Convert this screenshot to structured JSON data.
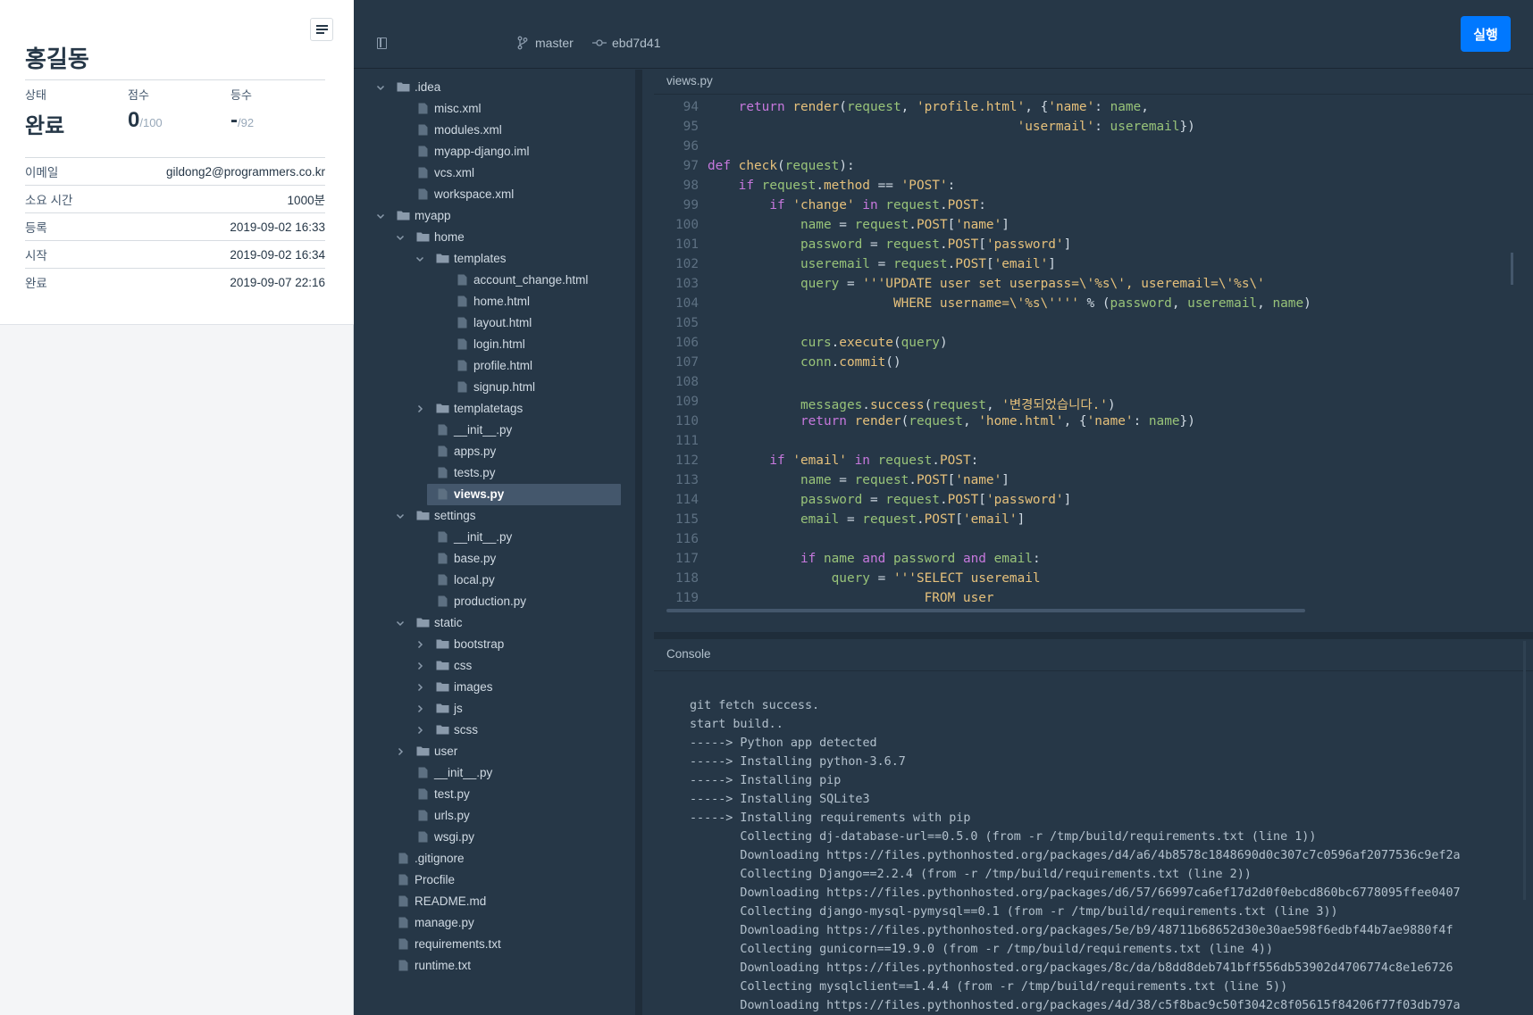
{
  "profile": {
    "name": "홍길동",
    "stats": [
      {
        "label": "상태",
        "value": "완료",
        "suffix": ""
      },
      {
        "label": "점수",
        "value": "0",
        "suffix": "/100"
      },
      {
        "label": "등수",
        "value": "-",
        "suffix": "/92"
      }
    ],
    "details": [
      {
        "key": "이메일",
        "value": "gildong2@programmers.co.kr"
      },
      {
        "key": "소요 시간",
        "value": "1000분"
      },
      {
        "key": "등록",
        "value": "2019-09-02 16:33"
      },
      {
        "key": "시작",
        "value": "2019-09-02 16:34"
      },
      {
        "key": "완료",
        "value": "2019-09-07 22:16"
      }
    ]
  },
  "topbar": {
    "branch": "master",
    "commit": "ebd7d41",
    "run_label": "실행"
  },
  "file_tree": [
    {
      "depth": 0,
      "type": "folder",
      "open": true,
      "name": ".idea"
    },
    {
      "depth": 1,
      "type": "file",
      "name": "misc.xml"
    },
    {
      "depth": 1,
      "type": "file",
      "name": "modules.xml"
    },
    {
      "depth": 1,
      "type": "file",
      "name": "myapp-django.iml"
    },
    {
      "depth": 1,
      "type": "file",
      "name": "vcs.xml"
    },
    {
      "depth": 1,
      "type": "file",
      "name": "workspace.xml"
    },
    {
      "depth": 0,
      "type": "folder",
      "open": true,
      "name": "myapp"
    },
    {
      "depth": 1,
      "type": "folder",
      "open": true,
      "name": "home"
    },
    {
      "depth": 2,
      "type": "folder",
      "open": true,
      "name": "templates"
    },
    {
      "depth": 3,
      "type": "file",
      "name": "account_change.html"
    },
    {
      "depth": 3,
      "type": "file",
      "name": "home.html"
    },
    {
      "depth": 3,
      "type": "file",
      "name": "layout.html"
    },
    {
      "depth": 3,
      "type": "file",
      "name": "login.html"
    },
    {
      "depth": 3,
      "type": "file",
      "name": "profile.html"
    },
    {
      "depth": 3,
      "type": "file",
      "name": "signup.html"
    },
    {
      "depth": 2,
      "type": "folder",
      "open": false,
      "name": "templatetags"
    },
    {
      "depth": 2,
      "type": "file",
      "name": "__init__.py"
    },
    {
      "depth": 2,
      "type": "file",
      "name": "apps.py"
    },
    {
      "depth": 2,
      "type": "file",
      "name": "tests.py"
    },
    {
      "depth": 2,
      "type": "file",
      "name": "views.py",
      "selected": true
    },
    {
      "depth": 1,
      "type": "folder",
      "open": true,
      "name": "settings"
    },
    {
      "depth": 2,
      "type": "file",
      "name": "__init__.py"
    },
    {
      "depth": 2,
      "type": "file",
      "name": "base.py"
    },
    {
      "depth": 2,
      "type": "file",
      "name": "local.py"
    },
    {
      "depth": 2,
      "type": "file",
      "name": "production.py"
    },
    {
      "depth": 1,
      "type": "folder",
      "open": true,
      "name": "static"
    },
    {
      "depth": 2,
      "type": "folder",
      "open": false,
      "name": "bootstrap"
    },
    {
      "depth": 2,
      "type": "folder",
      "open": false,
      "name": "css"
    },
    {
      "depth": 2,
      "type": "folder",
      "open": false,
      "name": "images"
    },
    {
      "depth": 2,
      "type": "folder",
      "open": false,
      "name": "js"
    },
    {
      "depth": 2,
      "type": "folder",
      "open": false,
      "name": "scss"
    },
    {
      "depth": 1,
      "type": "folder",
      "open": false,
      "name": "user"
    },
    {
      "depth": 1,
      "type": "file",
      "name": "__init__.py"
    },
    {
      "depth": 1,
      "type": "file",
      "name": "test.py"
    },
    {
      "depth": 1,
      "type": "file",
      "name": "urls.py"
    },
    {
      "depth": 1,
      "type": "file",
      "name": "wsgi.py"
    },
    {
      "depth": 0,
      "type": "file",
      "name": ".gitignore"
    },
    {
      "depth": 0,
      "type": "file",
      "name": "Procfile"
    },
    {
      "depth": 0,
      "type": "file",
      "name": "README.md"
    },
    {
      "depth": 0,
      "type": "file",
      "name": "manage.py"
    },
    {
      "depth": 0,
      "type": "file",
      "name": "requirements.txt"
    },
    {
      "depth": 0,
      "type": "file",
      "name": "runtime.txt"
    }
  ],
  "editor": {
    "tab": "views.py",
    "lines": [
      {
        "n": "94",
        "t": [
          [
            "    ",
            ""
          ],
          [
            "return",
            "kw"
          ],
          [
            " ",
            ""
          ],
          [
            "render",
            "fn"
          ],
          [
            "(",
            "pn"
          ],
          [
            "request",
            "dbg"
          ],
          [
            ", ",
            "pn"
          ],
          [
            "'profile.html'",
            "str"
          ],
          [
            ", {",
            "pn"
          ],
          [
            "'name'",
            "str"
          ],
          [
            ": ",
            "pn"
          ],
          [
            "name",
            "dbg"
          ],
          [
            ",",
            "pn"
          ]
        ]
      },
      {
        "n": "95",
        "t": [
          [
            "                                        ",
            ""
          ],
          [
            "'usermail'",
            "str"
          ],
          [
            ": ",
            "pn"
          ],
          [
            "useremail",
            "dbg"
          ],
          [
            "})",
            "pn"
          ]
        ]
      },
      {
        "n": "96",
        "t": []
      },
      {
        "n": "97",
        "t": [
          [
            "def",
            "kw"
          ],
          [
            " ",
            ""
          ],
          [
            "check",
            "fn"
          ],
          [
            "(",
            "pn"
          ],
          [
            "request",
            "dbg"
          ],
          [
            "):",
            "pn"
          ]
        ]
      },
      {
        "n": "98",
        "t": [
          [
            "    ",
            ""
          ],
          [
            "if",
            "kw"
          ],
          [
            " ",
            ""
          ],
          [
            "request",
            "dbg"
          ],
          [
            ".",
            "pn"
          ],
          [
            "method",
            "fn"
          ],
          [
            " == ",
            "pn"
          ],
          [
            "'POST'",
            "str"
          ],
          [
            ":",
            "pn"
          ]
        ]
      },
      {
        "n": "99",
        "t": [
          [
            "        ",
            ""
          ],
          [
            "if",
            "kw"
          ],
          [
            " ",
            ""
          ],
          [
            "'change'",
            "str"
          ],
          [
            " ",
            ""
          ],
          [
            "in",
            "kw"
          ],
          [
            " ",
            ""
          ],
          [
            "request",
            "dbg"
          ],
          [
            ".",
            "pn"
          ],
          [
            "POST",
            "fn"
          ],
          [
            ":",
            "pn"
          ]
        ]
      },
      {
        "n": "100",
        "t": [
          [
            "            ",
            ""
          ],
          [
            "name",
            "dbg"
          ],
          [
            " = ",
            "pn"
          ],
          [
            "request",
            "dbg"
          ],
          [
            ".",
            "pn"
          ],
          [
            "POST",
            "fn"
          ],
          [
            "[",
            "pn"
          ],
          [
            "'name'",
            "str"
          ],
          [
            "]",
            "pn"
          ]
        ]
      },
      {
        "n": "101",
        "t": [
          [
            "            ",
            ""
          ],
          [
            "password",
            "dbg"
          ],
          [
            " = ",
            "pn"
          ],
          [
            "request",
            "dbg"
          ],
          [
            ".",
            "pn"
          ],
          [
            "POST",
            "fn"
          ],
          [
            "[",
            "pn"
          ],
          [
            "'password'",
            "str"
          ],
          [
            "]",
            "pn"
          ]
        ]
      },
      {
        "n": "102",
        "t": [
          [
            "            ",
            ""
          ],
          [
            "useremail",
            "dbg"
          ],
          [
            " = ",
            "pn"
          ],
          [
            "request",
            "dbg"
          ],
          [
            ".",
            "pn"
          ],
          [
            "POST",
            "fn"
          ],
          [
            "[",
            "pn"
          ],
          [
            "'email'",
            "str"
          ],
          [
            "]",
            "pn"
          ]
        ]
      },
      {
        "n": "103",
        "t": [
          [
            "            ",
            ""
          ],
          [
            "query",
            "dbg"
          ],
          [
            " = ",
            "pn"
          ],
          [
            "'''UPDATE user set userpass=\\'%s\\', useremail=\\'%s\\'",
            "str"
          ]
        ]
      },
      {
        "n": "104",
        "t": [
          [
            "                        ",
            ""
          ],
          [
            "WHERE username=\\'%s\\''''",
            "str"
          ],
          [
            " % (",
            "pn"
          ],
          [
            "password",
            "dbg"
          ],
          [
            ", ",
            "pn"
          ],
          [
            "useremail",
            "dbg"
          ],
          [
            ", ",
            "pn"
          ],
          [
            "name",
            "dbg"
          ],
          [
            ")",
            "pn"
          ]
        ]
      },
      {
        "n": "105",
        "t": []
      },
      {
        "n": "106",
        "t": [
          [
            "            ",
            ""
          ],
          [
            "curs",
            "dbg"
          ],
          [
            ".",
            "pn"
          ],
          [
            "execute",
            "fn"
          ],
          [
            "(",
            "pn"
          ],
          [
            "query",
            "dbg"
          ],
          [
            ")",
            "pn"
          ]
        ]
      },
      {
        "n": "107",
        "t": [
          [
            "            ",
            ""
          ],
          [
            "conn",
            "dbg"
          ],
          [
            ".",
            "pn"
          ],
          [
            "commit",
            "fn"
          ],
          [
            "()",
            "pn"
          ]
        ]
      },
      {
        "n": "108",
        "t": []
      },
      {
        "n": "109",
        "t": [
          [
            "            ",
            ""
          ],
          [
            "messages",
            "dbg"
          ],
          [
            ".",
            "pn"
          ],
          [
            "success",
            "fn"
          ],
          [
            "(",
            "pn"
          ],
          [
            "request",
            "dbg"
          ],
          [
            ", ",
            "pn"
          ],
          [
            "'변경되었습니다.'",
            "str"
          ],
          [
            ")",
            "pn"
          ]
        ]
      },
      {
        "n": "110",
        "t": [
          [
            "            ",
            ""
          ],
          [
            "return",
            "kw"
          ],
          [
            " ",
            ""
          ],
          [
            "render",
            "fn"
          ],
          [
            "(",
            "pn"
          ],
          [
            "request",
            "dbg"
          ],
          [
            ", ",
            "pn"
          ],
          [
            "'home.html'",
            "str"
          ],
          [
            ", {",
            "pn"
          ],
          [
            "'name'",
            "str"
          ],
          [
            ": ",
            "pn"
          ],
          [
            "name",
            "dbg"
          ],
          [
            "})",
            "pn"
          ]
        ]
      },
      {
        "n": "111",
        "t": []
      },
      {
        "n": "112",
        "t": [
          [
            "        ",
            ""
          ],
          [
            "if",
            "kw"
          ],
          [
            " ",
            ""
          ],
          [
            "'email'",
            "str"
          ],
          [
            " ",
            ""
          ],
          [
            "in",
            "kw"
          ],
          [
            " ",
            ""
          ],
          [
            "request",
            "dbg"
          ],
          [
            ".",
            "pn"
          ],
          [
            "POST",
            "fn"
          ],
          [
            ":",
            "pn"
          ]
        ]
      },
      {
        "n": "113",
        "t": [
          [
            "            ",
            ""
          ],
          [
            "name",
            "dbg"
          ],
          [
            " = ",
            "pn"
          ],
          [
            "request",
            "dbg"
          ],
          [
            ".",
            "pn"
          ],
          [
            "POST",
            "fn"
          ],
          [
            "[",
            "pn"
          ],
          [
            "'name'",
            "str"
          ],
          [
            "]",
            "pn"
          ]
        ]
      },
      {
        "n": "114",
        "t": [
          [
            "            ",
            ""
          ],
          [
            "password",
            "dbg"
          ],
          [
            " = ",
            "pn"
          ],
          [
            "request",
            "dbg"
          ],
          [
            ".",
            "pn"
          ],
          [
            "POST",
            "fn"
          ],
          [
            "[",
            "pn"
          ],
          [
            "'password'",
            "str"
          ],
          [
            "]",
            "pn"
          ]
        ]
      },
      {
        "n": "115",
        "t": [
          [
            "            ",
            ""
          ],
          [
            "email",
            "dbg"
          ],
          [
            " = ",
            "pn"
          ],
          [
            "request",
            "dbg"
          ],
          [
            ".",
            "pn"
          ],
          [
            "POST",
            "fn"
          ],
          [
            "[",
            "pn"
          ],
          [
            "'email'",
            "str"
          ],
          [
            "]",
            "pn"
          ]
        ]
      },
      {
        "n": "116",
        "t": []
      },
      {
        "n": "117",
        "t": [
          [
            "            ",
            ""
          ],
          [
            "if",
            "kw"
          ],
          [
            " ",
            ""
          ],
          [
            "name",
            "dbg"
          ],
          [
            " ",
            ""
          ],
          [
            "and",
            "kw"
          ],
          [
            " ",
            ""
          ],
          [
            "password",
            "dbg"
          ],
          [
            " ",
            ""
          ],
          [
            "and",
            "kw"
          ],
          [
            " ",
            ""
          ],
          [
            "email",
            "dbg"
          ],
          [
            ":",
            "pn"
          ]
        ]
      },
      {
        "n": "118",
        "t": [
          [
            "                ",
            ""
          ],
          [
            "query",
            "dbg"
          ],
          [
            " = ",
            "pn"
          ],
          [
            "'''SELECT useremail",
            "str"
          ]
        ]
      },
      {
        "n": "119",
        "t": [
          [
            "                            ",
            ""
          ],
          [
            "FROM user",
            "str"
          ]
        ]
      }
    ]
  },
  "console": {
    "title": "Console",
    "lines": [
      "git fetch success.",
      "start build..",
      "-----> Python app detected",
      "-----> Installing python-3.6.7",
      "-----> Installing pip",
      "-----> Installing SQLite3",
      "-----> Installing requirements with pip",
      "       Collecting dj-database-url==0.5.0 (from -r /tmp/build/requirements.txt (line 1))",
      "       Downloading https://files.pythonhosted.org/packages/d4/a6/4b8578c1848690d0c307c7c0596af2077536c9ef2a",
      "       Collecting Django==2.2.4 (from -r /tmp/build/requirements.txt (line 2))",
      "       Downloading https://files.pythonhosted.org/packages/d6/57/66997ca6ef17d2d0f0ebcd860bc6778095ffee0407",
      "       Collecting django-mysql-pymysql==0.1 (from -r /tmp/build/requirements.txt (line 3))",
      "       Downloading https://files.pythonhosted.org/packages/5e/b9/48711b68652d30e30ae598f6edbf44b7ae9880f4f",
      "       Collecting gunicorn==19.9.0 (from -r /tmp/build/requirements.txt (line 4))",
      "       Downloading https://files.pythonhosted.org/packages/8c/da/b8dd8deb741bff556db53902d4706774c8e1e6726",
      "       Collecting mysqlclient==1.4.4 (from -r /tmp/build/requirements.txt (line 5))",
      "       Downloading https://files.pythonhosted.org/packages/4d/38/c5f8bac9c50f3042c8f05615f84206f77f03db797a"
    ]
  },
  "colors": {
    "accent": "#0078ff",
    "ide_bg": "#263747",
    "keyword": "#c678dd",
    "string": "#e5c07b",
    "identifier": "#98c379"
  }
}
